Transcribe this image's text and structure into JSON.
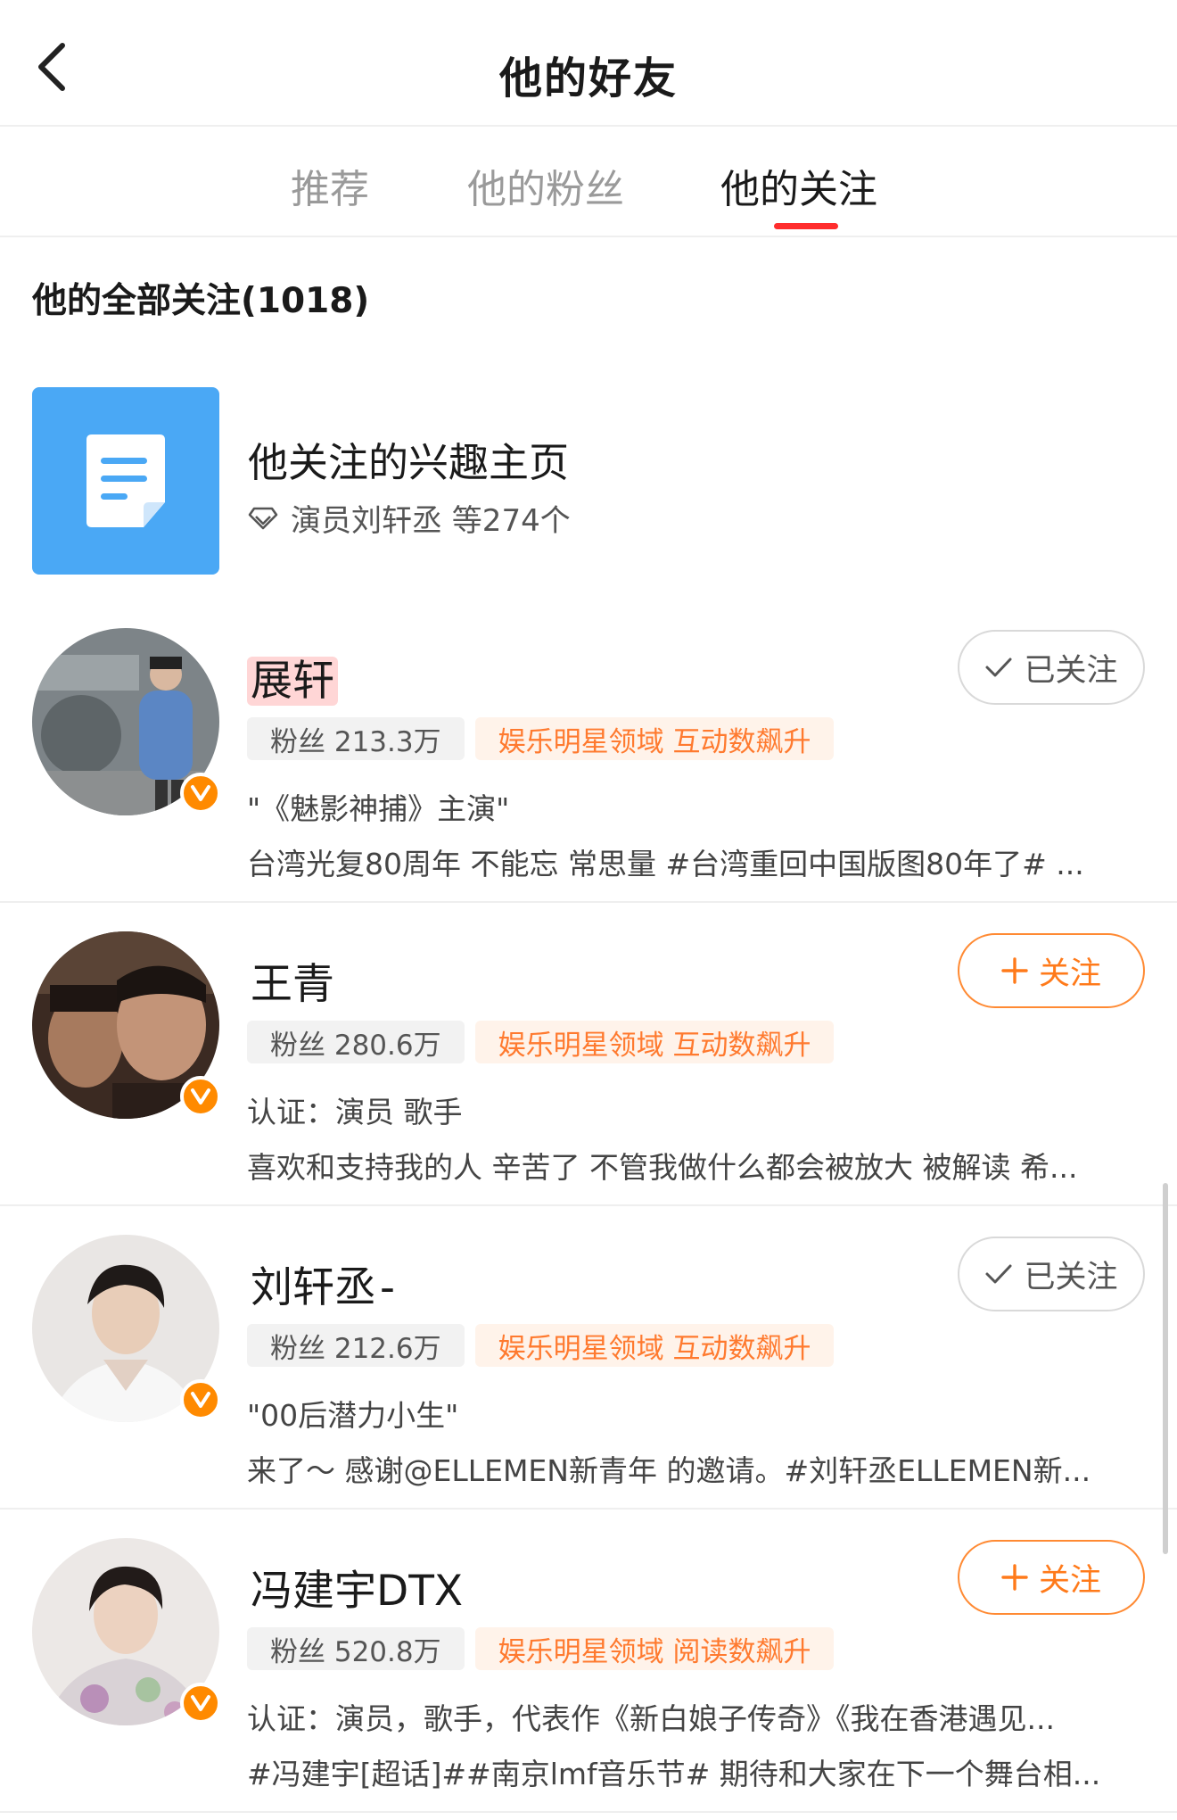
{
  "header": {
    "back_icon": "chevron-left-icon",
    "title": "他的好友"
  },
  "tabs": [
    {
      "label": "推荐",
      "active": false
    },
    {
      "label": "他的粉丝",
      "active": false
    },
    {
      "label": "他的关注",
      "active": true
    }
  ],
  "accent_color": "#ff2d2d",
  "section_title": "他的全部关注(1018)",
  "interest_page": {
    "icon": "document-icon",
    "title": "他关注的兴趣主页",
    "sub_icon": "diamond-icon",
    "subtitle": "演员刘轩丞 等274个"
  },
  "users": [
    {
      "name": "展轩",
      "name_highlight": "#ffd6d6",
      "fans": "粉丝 213.3万",
      "field": "娱乐明星领域 互动数飙升",
      "desc1": "\"《魅影神捕》主演\"",
      "desc2": "台湾光复80周年 不能忘 常思量 #台湾重回中国版图80年了# ...",
      "follow_label": "已关注",
      "followed": true,
      "verified_icon": "verified-v-icon"
    },
    {
      "name": "王青",
      "name_highlight": "",
      "fans": "粉丝 280.6万",
      "field": "娱乐明星领域 互动数飙升",
      "desc1": "认证：演员 歌手",
      "desc2": "喜欢和支持我的人 辛苦了 不管我做什么都会被放大 被解读 希...",
      "follow_label": "关注",
      "followed": false,
      "verified_icon": "verified-v-icon"
    },
    {
      "name": "刘轩丞",
      "name_suffix": "-",
      "name_highlight": "#d9f5c8",
      "fans": "粉丝 212.6万",
      "field": "娱乐明星领域 互动数飙升",
      "desc1": "\"00后潜力小生\"",
      "desc2": "来了～ 感谢@ELLEMEN新青年 的邀请。#刘轩丞ELLEMEN新...",
      "follow_label": "已关注",
      "followed": true,
      "verified_icon": "verified-v-icon"
    },
    {
      "name": "冯建宇DTX",
      "name_highlight": "",
      "fans": "粉丝 520.8万",
      "field": "娱乐明星领域 阅读数飙升",
      "desc1": "认证：演员，歌手，代表作《新白娘子传奇》《我在香港遇见...",
      "desc2": "#冯建宇[超话]##南京lmf音乐节# 期待和大家在下一个舞台相...",
      "follow_label": "关注",
      "followed": false,
      "verified_icon": "verified-v-icon"
    }
  ]
}
